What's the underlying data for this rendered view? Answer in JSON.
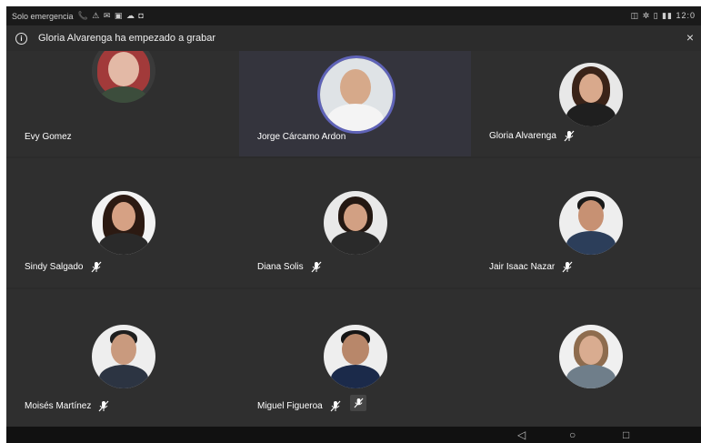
{
  "status_bar": {
    "left_text": "Solo emergencia",
    "left_icons": "📞 ⚠ ✉ ▣ ☁ ◘",
    "right_text": "◫ ✲ ▯ ▮▮ 12:0"
  },
  "banner": {
    "message": "Gloria Alvarenga ha empezado a grabar",
    "info_icon": "info-icon",
    "close_label": "×"
  },
  "participants": [
    {
      "name": "Evy Gomez",
      "muted": false,
      "active": false
    },
    {
      "name": "Jorge Cárcamo Ardon",
      "muted": false,
      "active": true
    },
    {
      "name": "Gloria Alvarenga",
      "muted": true,
      "active": false
    },
    {
      "name": "Sindy Salgado",
      "muted": true,
      "active": false
    },
    {
      "name": "Diana Solis",
      "muted": true,
      "active": false
    },
    {
      "name": "Jair Isaac Nazar",
      "muted": true,
      "active": false
    },
    {
      "name": "Moisés Martínez",
      "muted": true,
      "active": false
    },
    {
      "name": "Miguel Figueroa",
      "muted": true,
      "active": false
    },
    {
      "name": "",
      "muted": false,
      "active": false
    }
  ],
  "nav_bar": {
    "back": "◁",
    "home": "○",
    "recents": "□"
  },
  "colors": {
    "tile_bg": "#2f2f2f",
    "active_tile_bg": "#34343d",
    "active_ring": "#5f63b8",
    "text": "#ffffff"
  }
}
